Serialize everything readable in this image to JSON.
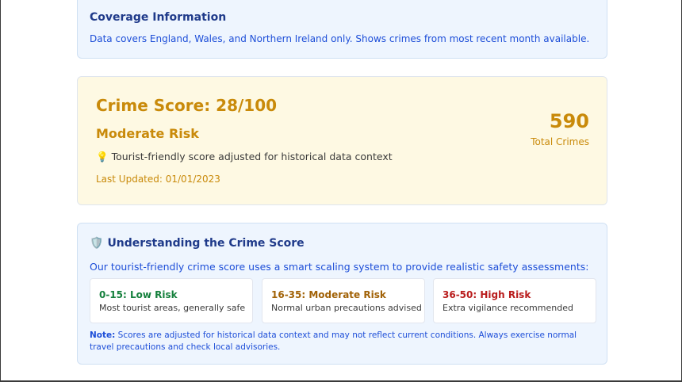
{
  "coverage": {
    "title": "Coverage Information",
    "description": "Data covers England, Wales, and Northern Ireland only. Shows crimes from most recent month available."
  },
  "score": {
    "title": "Crime Score: 28/100",
    "level": "Moderate Risk",
    "hint_icon": "💡",
    "hint": "Tourist-friendly score adjusted for historical data context",
    "last_updated": "Last Updated: 01/01/2023",
    "total_value": "590",
    "total_label": "Total Crimes"
  },
  "understanding": {
    "icon": "🛡️",
    "title": "Understanding the Crime Score",
    "description": "Our tourist-friendly crime score uses a smart scaling system to provide realistic safety assessments:",
    "ranges": [
      {
        "title": "0-15: Low Risk",
        "description": "Most tourist areas, generally safe"
      },
      {
        "title": "16-35: Moderate Risk",
        "description": "Normal urban precautions advised"
      },
      {
        "title": "36-50: High Risk",
        "description": "Extra vigilance recommended"
      }
    ],
    "note_label": "Note:",
    "note_text": " Scores are adjusted for historical data context and may not reflect current conditions. Always exercise normal travel precautions and check local advisories."
  },
  "colors": {
    "low": "#15803d",
    "moderate": "#a16207",
    "high": "#b91c1c",
    "score_accent": "#c98a0a"
  }
}
